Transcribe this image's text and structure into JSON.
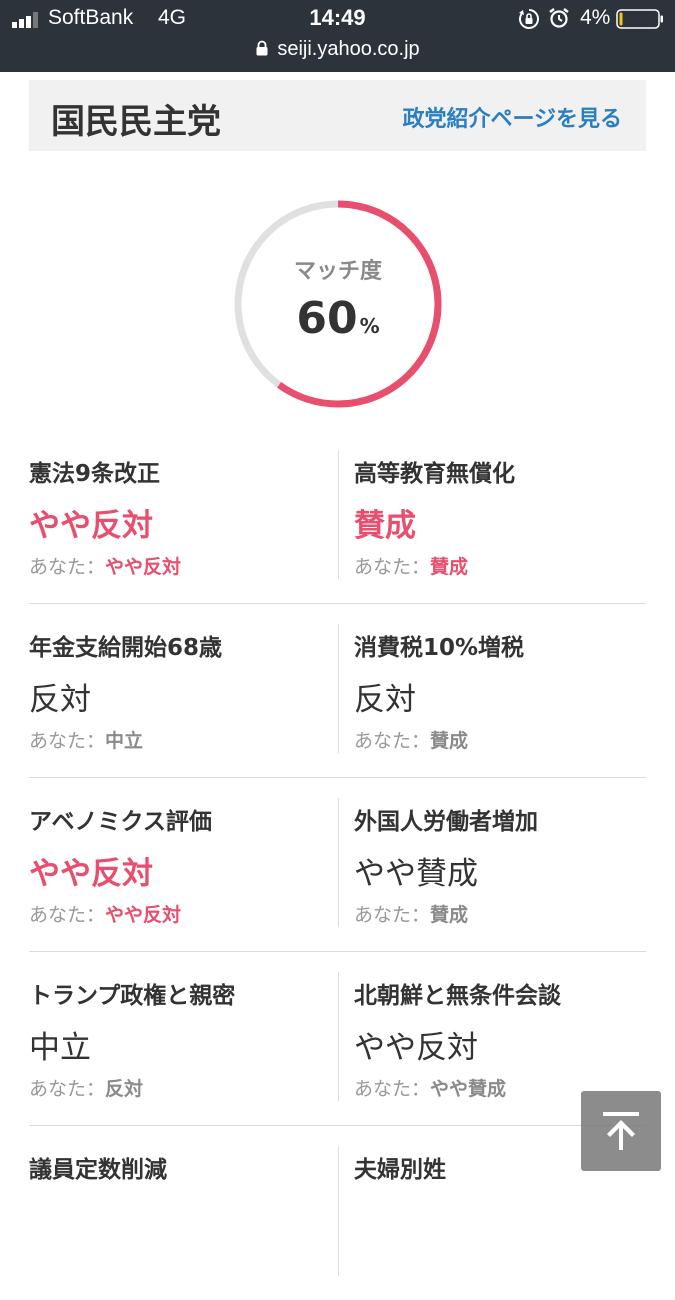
{
  "status_bar": {
    "carrier": "SoftBank",
    "network": "4G",
    "time": "14:49",
    "battery_percent": "4%",
    "battery_level": 0.04,
    "battery_color": "#f5c518",
    "icons": [
      "signal-icon",
      "orientation-lock-icon",
      "alarm-icon",
      "battery-icon"
    ]
  },
  "browser": {
    "url": "seiji.yahoo.co.jp",
    "icon": "lock-icon"
  },
  "party": {
    "name": "国民民主党",
    "link_label": "政党紹介ページを見る",
    "link_color": "#2a7ec2"
  },
  "match": {
    "label": "マッチ度",
    "value": "60",
    "unit": "%",
    "fraction": 0.6,
    "ring_color": "#e84e6e",
    "ring_track_color": "#e0e0e0"
  },
  "you_label": "あなた：",
  "accent_color": "#e84e6e",
  "issues": [
    {
      "topic": "憲法9条改正",
      "stance": "やや反対",
      "you": "やや反対",
      "match": true
    },
    {
      "topic": "高等教育無償化",
      "stance": "賛成",
      "you": "賛成",
      "match": true
    },
    {
      "topic": "年金支給開始68歳",
      "stance": "反対",
      "you": "中立",
      "match": false
    },
    {
      "topic": "消費税10%増税",
      "stance": "反対",
      "you": "賛成",
      "match": false
    },
    {
      "topic": "アベノミクス評価",
      "stance": "やや反対",
      "you": "やや反対",
      "match": true
    },
    {
      "topic": "外国人労働者増加",
      "stance": "やや賛成",
      "you": "賛成",
      "match": false
    },
    {
      "topic": "トランプ政権と親密",
      "stance": "中立",
      "you": "反対",
      "match": false
    },
    {
      "topic": "北朝鮮と無条件会談",
      "stance": "やや反対",
      "you": "やや賛成",
      "match": false
    },
    {
      "topic": "議員定数削減"
    },
    {
      "topic": "夫婦別姓"
    }
  ],
  "scroll_top_button": {
    "icon": "arrow-up-to-top-icon"
  }
}
